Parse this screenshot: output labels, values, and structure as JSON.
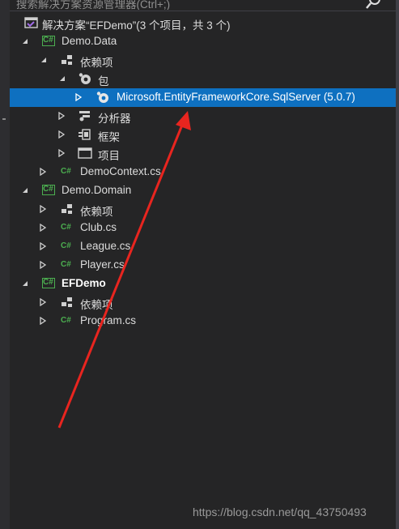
{
  "search": {
    "placeholder": "搜索解决方案资源管理器(Ctrl+;)"
  },
  "tree": {
    "solution": "解决方案“EFDemo”(3 个项目，共 3 个)",
    "data_project": "Demo.Data",
    "data_deps": "依赖项",
    "data_pkg": "包",
    "data_pkg_item": "Microsoft.EntityFrameworkCore.SqlServer (5.0.7)",
    "data_analyzers": "分析器",
    "data_frameworks": "框架",
    "data_projects": "项目",
    "data_context": "DemoContext.cs",
    "domain_project": "Demo.Domain",
    "domain_deps": "依赖项",
    "domain_club": "Club.cs",
    "domain_league": "League.cs",
    "domain_player": "Player.cs",
    "ef_project": "EFDemo",
    "ef_deps": "依赖项",
    "ef_program": "Program.cs"
  },
  "annotation": {
    "arrow_color": "#e8251f"
  },
  "watermark": "https://blog.csdn.net/qq_43750493",
  "colors": {
    "selection": "#0e70c0",
    "csharp": "#4caf50",
    "background": "#252526"
  }
}
